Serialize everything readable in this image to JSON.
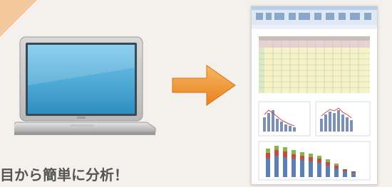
{
  "caption": {
    "text": "目から簡単に分析！"
  },
  "icons": {
    "corner": "corner-triangle-decoration",
    "laptop": "laptop-icon",
    "arrow": "arrow-right-icon",
    "preview": "spreadsheet-preview-icon"
  },
  "colors": {
    "background": "#f4f0ec",
    "accent_orange": "#f39a35",
    "corner_decoration": "#f6c79c",
    "laptop_screen": "#5ab8e0",
    "caption_text": "#555555"
  }
}
